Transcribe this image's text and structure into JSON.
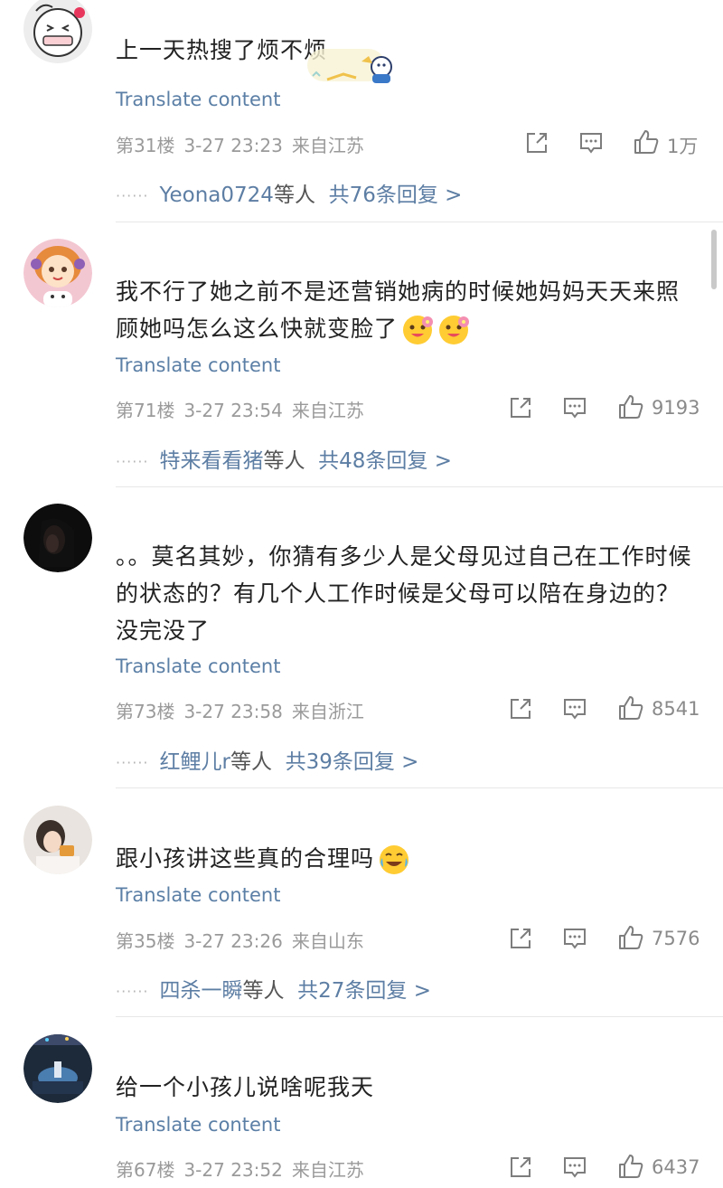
{
  "translate_label": "Translate content",
  "comments": [
    {
      "text": "上一天热搜了烦不烦",
      "floor": "第31楼",
      "time": "3-27 23:23",
      "location": "来自江苏",
      "likes": "1万",
      "reply_users": "Yeona0724",
      "reply_suffix": "等人",
      "reply_total": "共76条回复 >"
    },
    {
      "text": "我不行了她之前不是还营销她病的时候她妈妈天天来照顾她吗怎么这么快就变脸了",
      "floor": "第71楼",
      "time": "3-27 23:54",
      "location": "来自江苏",
      "likes": "9193",
      "reply_users": "特来看看猪",
      "reply_suffix": "等人",
      "reply_total": "共48条回复 >"
    },
    {
      "text": "。。莫名其妙，你猜有多少人是父母见过自己在工作时候的状态的？有几个人工作时候是父母可以陪在身边的？没完没了",
      "floor": "第73楼",
      "time": "3-27 23:58",
      "location": "来自浙江",
      "likes": "8541",
      "reply_users": "红鲤儿r",
      "reply_suffix": "等人",
      "reply_total": "共39条回复 >"
    },
    {
      "text": "跟小孩讲这些真的合理吗",
      "floor": "第35楼",
      "time": "3-27 23:26",
      "location": "来自山东",
      "likes": "7576",
      "reply_users": "四杀一瞬",
      "reply_suffix": "等人",
      "reply_total": "共27条回复 >"
    },
    {
      "text": "给一个小孩儿说啥呢我天",
      "floor": "第67楼",
      "time": "3-27 23:52",
      "location": "来自江苏",
      "likes": "6437"
    }
  ],
  "icons": {
    "share": "share-icon",
    "comment": "comment-icon",
    "like": "like-icon"
  },
  "colors": {
    "link": "#5b7fa6",
    "meta": "#9a9a9a",
    "reply": "#5d7ea4"
  }
}
